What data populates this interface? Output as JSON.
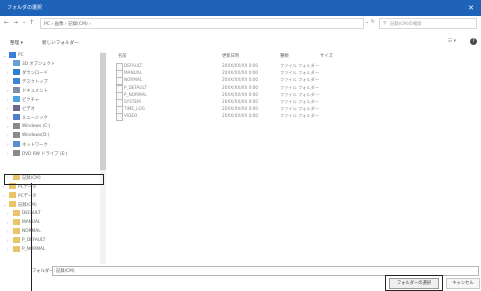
{
  "title_bar": {
    "title": "フォルダの選択",
    "close_glyph": "✕"
  },
  "nav": {
    "back": "←",
    "forward": "→",
    "up_menu": "⌄",
    "up": "↑",
    "address": "PC › 画像 › 記録(CM) ›",
    "refresh": "⌄  ↻",
    "search_placeholder": "記録(CM)の検索",
    "search_icon": "⚲"
  },
  "toolbar": {
    "organize": "整理 ▾",
    "new_folder": "新しいフォルダー",
    "view": "☷ ▾",
    "help": "?"
  },
  "tree": [
    {
      "label": "PC",
      "chevron": "⌄",
      "indent": 0,
      "icon": "pc-icon"
    },
    {
      "label": "3D オブジェクト",
      "chevron": "›",
      "indent": 1,
      "icon": "cube-icon"
    },
    {
      "label": "ダウンロード",
      "chevron": "›",
      "indent": 1,
      "icon": "download-icon"
    },
    {
      "label": "デスクトップ",
      "chevron": "›",
      "indent": 1,
      "icon": "desktop-icon"
    },
    {
      "label": "ドキュメント",
      "chevron": "›",
      "indent": 1,
      "icon": "document-icon"
    },
    {
      "label": "ピクチャ",
      "chevron": "›",
      "indent": 1,
      "icon": "picture-icon"
    },
    {
      "label": "ビデオ",
      "chevron": "›",
      "indent": 1,
      "icon": "video-icon"
    },
    {
      "label": "ミュージック",
      "chevron": "›",
      "indent": 1,
      "icon": "music-icon"
    },
    {
      "label": "Windows (C:)",
      "chevron": "›",
      "indent": 1,
      "icon": "drive-icon"
    },
    {
      "label": "Windows(D:)",
      "chevron": "›",
      "indent": 1,
      "icon": "drive-icon"
    },
    {
      "label": "ネットワーク",
      "chevron": "›",
      "indent": 1,
      "icon": "network-icon"
    },
    {
      "label": "DVD RW ドライブ (E:)",
      "chevron": "›",
      "indent": 1,
      "icon": "dvd-icon"
    },
    {
      "label": "記録(CM)",
      "chevron": "›",
      "indent": 1,
      "icon": "folder-icon"
    },
    {
      "label": "PCデータ",
      "chevron": "›",
      "indent": 0,
      "icon": "folder-icon"
    },
    {
      "label": "PCデータ",
      "chevron": "›",
      "indent": 0,
      "icon": "folder-icon"
    },
    {
      "label": "記録(CM)",
      "chevron": "⌄",
      "indent": 0,
      "icon": "folder-icon"
    },
    {
      "label": "DEFAULT",
      "chevron": "›",
      "indent": 1,
      "icon": "folder-icon"
    },
    {
      "label": "MANUAL",
      "chevron": "›",
      "indent": 1,
      "icon": "folder-icon"
    },
    {
      "label": "NORMAL",
      "chevron": "›",
      "indent": 1,
      "icon": "folder-icon"
    },
    {
      "label": "P_DEFAULT",
      "chevron": "›",
      "indent": 1,
      "icon": "folder-icon"
    },
    {
      "label": "P_NORMAL",
      "chevron": "›",
      "indent": 1,
      "icon": "folder-icon"
    }
  ],
  "columns": {
    "name": "名前",
    "date": "更新日時",
    "type": "種類",
    "size": "サイズ"
  },
  "files": [
    {
      "name": "DEFAULT",
      "date": "20XX/XX/XX 0:00",
      "type": "ファイル フォルダー"
    },
    {
      "name": "MANUAL",
      "date": "20XX/XX/XX 0:00",
      "type": "ファイル フォルダー"
    },
    {
      "name": "NORMAL",
      "date": "20XX/XX/XX 0:00",
      "type": "ファイル フォルダー"
    },
    {
      "name": "P_DEFAULT",
      "date": "20XX/XX/XX 0:00",
      "type": "ファイル フォルダー"
    },
    {
      "name": "P_NORMAL",
      "date": "20XX/XX/XX 0:00",
      "type": "ファイル フォルダー"
    },
    {
      "name": "SYSTEM",
      "date": "20XX/XX/XX 0:00",
      "type": "ファイル フォルダー"
    },
    {
      "name": "TIME_LOG",
      "date": "20XX/XX/XX 0:00",
      "type": "ファイル フォルダー"
    },
    {
      "name": "VIDEO",
      "date": "20XX/XX/XX 0:00",
      "type": "ファイル フォルダー"
    }
  ],
  "filename_bar": {
    "label": "フォルダー:",
    "value": "記録(CM)"
  },
  "buttons": {
    "select_folder": "フォルダーの選択",
    "cancel": "キャンセル"
  },
  "colors": {
    "title_bar": "#1f63b8",
    "highlight_outline": "#222222"
  }
}
